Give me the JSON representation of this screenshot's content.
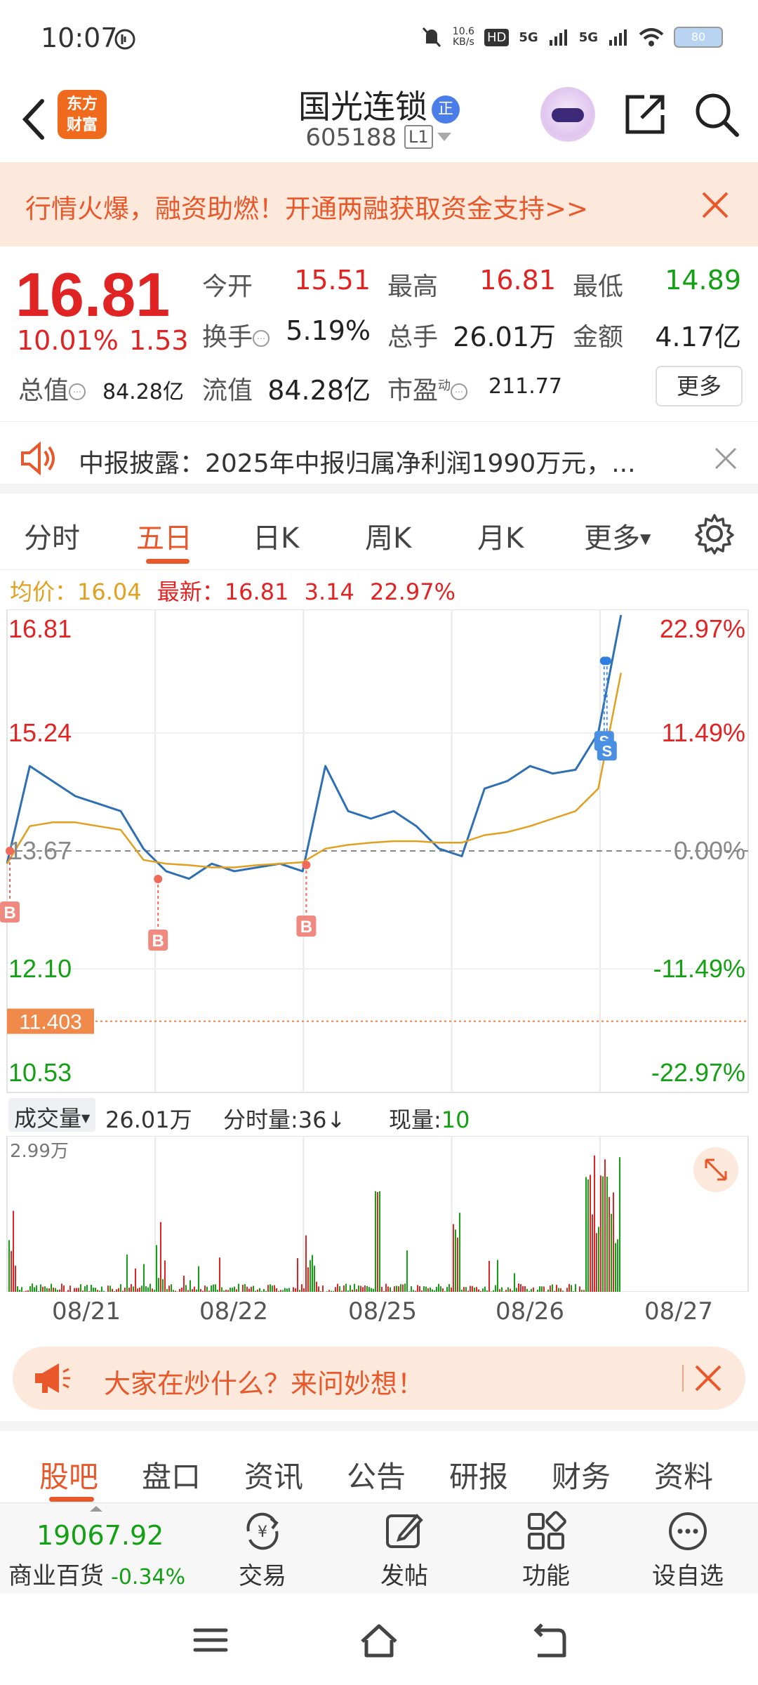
{
  "status": {
    "time": "10:07",
    "net_speed_top": "10.6",
    "net_speed_bottom": "KB/s",
    "hd": "HD",
    "sig1": "5G",
    "sig2": "5G",
    "battery": "80"
  },
  "header": {
    "logo_line1": "东方",
    "logo_line2": "财富",
    "stock_name": "国光连锁",
    "badge": "正",
    "stock_code": "605188",
    "level": "L1"
  },
  "banner": {
    "text": "行情火爆，融资助燃！开通两融获取资金支持>>"
  },
  "quote": {
    "price": "16.81",
    "change_pct": "10.01%",
    "change": "1.53",
    "open_label": "今开",
    "open": "15.51",
    "high_label": "最高",
    "high": "16.81",
    "low_label": "最低",
    "low": "14.89",
    "turnover_label": "换手",
    "turnover": "5.19%",
    "volume_label": "总手",
    "volume": "26.01万",
    "amount_label": "金额",
    "amount": "4.17亿",
    "mktcap_label": "总值",
    "mktcap": "84.28亿",
    "float_label": "流值",
    "float": "84.28亿",
    "pe_label": "市盈",
    "pe_sup": "动",
    "pe": "211.77",
    "more": "更多"
  },
  "news": {
    "text": "中报披露：2025年中报归属净利润1990万元，..."
  },
  "tabs": [
    "分时",
    "五日",
    "日K",
    "周K",
    "月K",
    "更多"
  ],
  "active_tab": "五日",
  "avg_row": {
    "avg_label": "均价：",
    "avg": "16.04",
    "latest_label": "最新：",
    "latest": "16.81",
    "chg": "3.14",
    "pct": "22.97%"
  },
  "chart_data": {
    "type": "line",
    "title": "",
    "x": [
      "08/21",
      "08/22",
      "08/25",
      "08/26",
      "08/27"
    ],
    "y_left_ticks": [
      "16.81",
      "15.24",
      "13.67",
      "12.10",
      "10.53"
    ],
    "y_right_ticks": [
      "22.97%",
      "11.49%",
      "0.00%",
      "-11.49%",
      "-22.97%"
    ],
    "ylim": [
      10.53,
      16.81
    ],
    "reference_price": "13.67",
    "marker_price": "11.403",
    "markers": [
      {
        "label": "B",
        "day": 1
      },
      {
        "label": "B",
        "day": 2
      },
      {
        "label": "B",
        "day": 3
      },
      {
        "label": "S",
        "day": 4
      },
      {
        "label": "S",
        "day": 4
      }
    ],
    "series": [
      {
        "values": [
          13.5,
          14.8,
          14.6,
          14.4,
          14.3,
          14.2,
          13.7,
          13.4,
          13.3,
          13.5,
          13.4,
          13.45,
          13.5,
          13.4,
          14.8,
          14.2,
          14.1,
          14.2,
          14.0,
          13.7,
          13.6,
          14.5,
          14.6,
          14.8,
          14.7,
          14.75,
          15.24,
          16.81
        ]
      },
      {
        "values": [
          13.5,
          14.0,
          14.05,
          14.05,
          14.0,
          13.95,
          13.55,
          13.5,
          13.48,
          13.45,
          13.45,
          13.48,
          13.5,
          13.52,
          13.7,
          13.75,
          13.78,
          13.8,
          13.8,
          13.78,
          13.78,
          13.88,
          13.92,
          14.0,
          14.1,
          14.2,
          14.5,
          16.04
        ]
      }
    ]
  },
  "volume": {
    "selector": "成交量",
    "total": "26.01万",
    "tick_label": "分时量:36↓",
    "now_label": "现量:",
    "now": "10",
    "max": "2.99万"
  },
  "ask": {
    "text": "大家在炒什么？来问妙想！"
  },
  "bottom_tabs": [
    "股吧",
    "盘口",
    "资讯",
    "公告",
    "研报",
    "财务",
    "资料"
  ],
  "toolbar": {
    "index_value": "19067.92",
    "index_name": "商业百货",
    "index_pct": "-0.34%",
    "trade": "交易",
    "post": "发帖",
    "func": "功能",
    "watch": "设自选"
  },
  "colors": {
    "accent": "#e8582a",
    "up": "#e02424",
    "down": "#14a014",
    "price_line": "#2f6fb3",
    "avg_line": "#e0a020"
  }
}
